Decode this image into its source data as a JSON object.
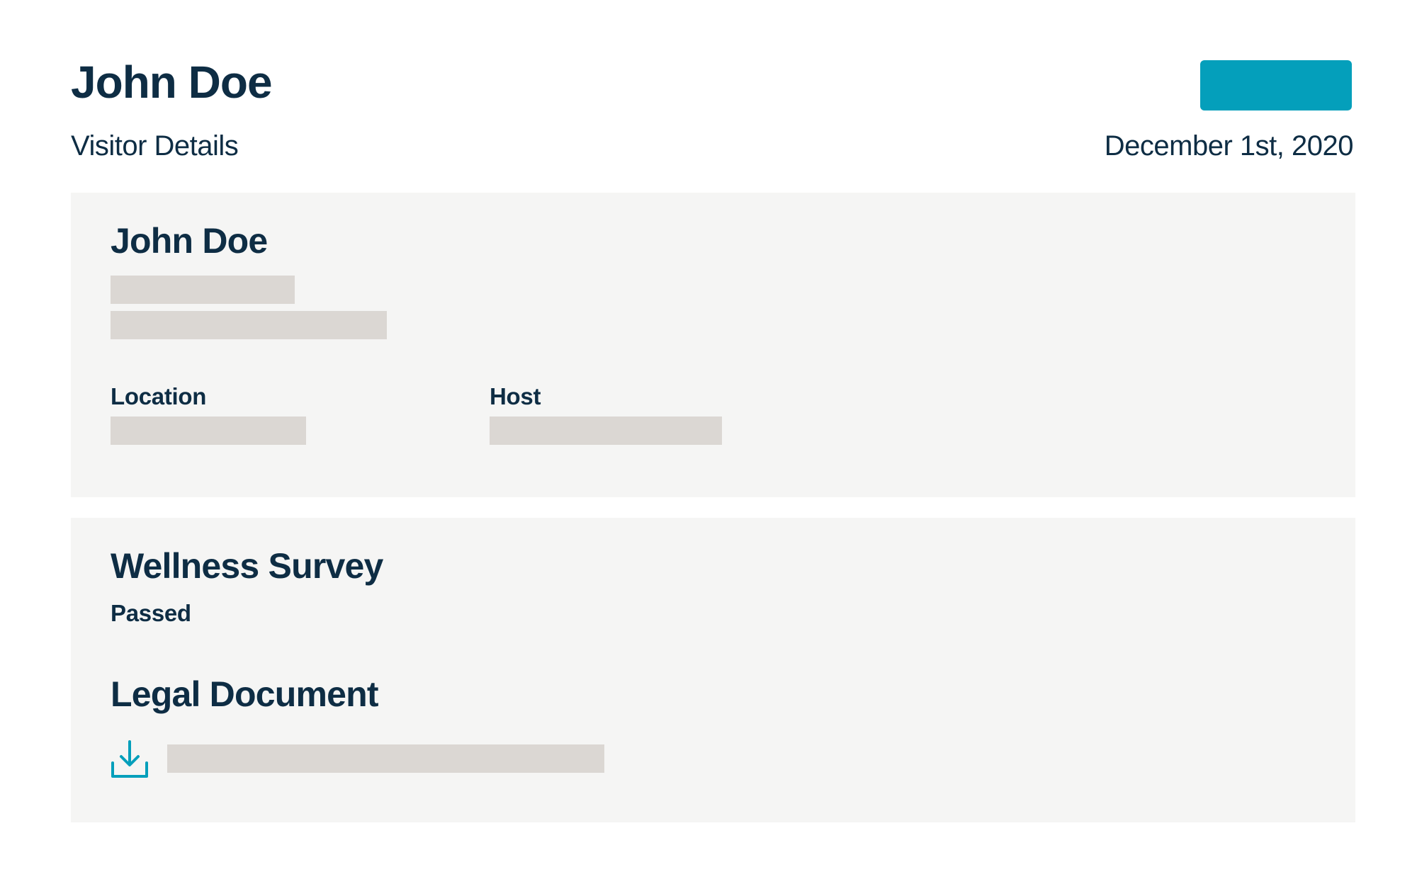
{
  "header": {
    "title": "John Doe",
    "subtitle": "Visitor Details",
    "date": "December 1st, 2020",
    "action_button_label": "",
    "accent_color": "#049fbb"
  },
  "visitor_card": {
    "name": "John Doe",
    "fields": [
      {
        "label": "Location",
        "value": ""
      },
      {
        "label": "Host",
        "value": ""
      }
    ]
  },
  "survey_card": {
    "wellness_heading": "Wellness Survey",
    "wellness_status": "Passed",
    "legal_heading": "Legal Document",
    "legal_icon": "download-icon"
  }
}
